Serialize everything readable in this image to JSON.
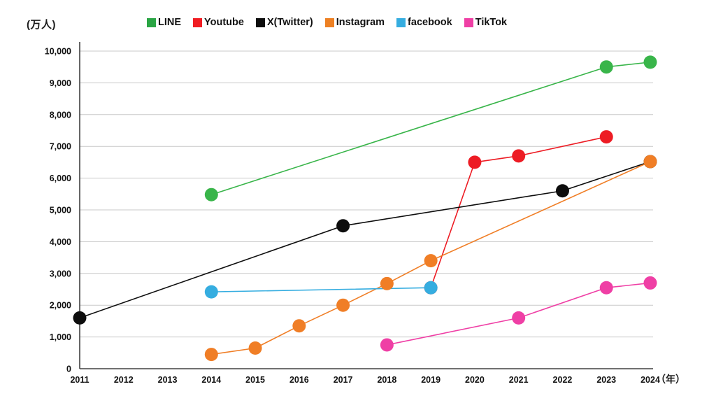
{
  "axis": {
    "y_unit_label": "(万人)",
    "x_unit_label": "（年）",
    "y_ticks": [
      "10,000",
      "9,000",
      "8,000",
      "7,000",
      "6,000",
      "5,000",
      "4,000",
      "3,000",
      "2,000",
      "1,000",
      "0"
    ],
    "x_ticks": [
      "2011",
      "2012",
      "2013",
      "2014",
      "2015",
      "2016",
      "2017",
      "2018",
      "2019",
      "2020",
      "2021",
      "2022",
      "2023",
      "2024"
    ]
  },
  "legend": {
    "items": [
      {
        "label": "LINE",
        "color": "#2aa544"
      },
      {
        "label": "Youtube",
        "color": "#f01c22"
      },
      {
        "label": "X(Twitter)",
        "color": "#0d0d0d"
      },
      {
        "label": "Instagram",
        "color": "#ed8023"
      },
      {
        "label": "facebook",
        "color": "#35ade0"
      },
      {
        "label": "TikTok",
        "color": "#ef3fa5"
      }
    ]
  },
  "colors": {
    "gridline": "#c9c9c9",
    "axis": "#404040",
    "background": "#ffffff",
    "line_green": "#39b54a",
    "line_red": "#ed1c24",
    "line_black": "#0d0d0d",
    "line_orange": "#f07e26",
    "line_blue": "#35ade0",
    "line_pink": "#ef3fa5"
  },
  "chart_data": {
    "type": "line",
    "title": "",
    "xlabel": "（年）",
    "ylabel": "(万人)",
    "x": [
      2011,
      2012,
      2013,
      2014,
      2015,
      2016,
      2017,
      2018,
      2019,
      2020,
      2021,
      2022,
      2023,
      2024
    ],
    "xlim": [
      2011,
      2024
    ],
    "ylim": [
      0,
      10000
    ],
    "y_tick_step": 1000,
    "grid": true,
    "legend_position": "top",
    "series": [
      {
        "name": "LINE",
        "color": "#39b54a",
        "points": [
          {
            "x": 2014,
            "y": 5480
          },
          {
            "x": 2023,
            "y": 9500
          },
          {
            "x": 2024,
            "y": 9650
          }
        ]
      },
      {
        "name": "Youtube",
        "color": "#ed1c24",
        "points": [
          {
            "x": 2019,
            "y": 2550
          },
          {
            "x": 2020,
            "y": 6500
          },
          {
            "x": 2021,
            "y": 6700
          },
          {
            "x": 2023,
            "y": 7300
          }
        ]
      },
      {
        "name": "X(Twitter)",
        "color": "#0d0d0d",
        "points": [
          {
            "x": 2011,
            "y": 1600
          },
          {
            "x": 2017,
            "y": 4500
          },
          {
            "x": 2022,
            "y": 5600
          },
          {
            "x": 2024,
            "y": 6520
          }
        ]
      },
      {
        "name": "Instagram",
        "color": "#f07e26",
        "points": [
          {
            "x": 2014,
            "y": 450
          },
          {
            "x": 2015,
            "y": 650
          },
          {
            "x": 2016,
            "y": 1350
          },
          {
            "x": 2017,
            "y": 2000
          },
          {
            "x": 2018,
            "y": 2680
          },
          {
            "x": 2019,
            "y": 3400
          },
          {
            "x": 2024,
            "y": 6520
          }
        ]
      },
      {
        "name": "facebook",
        "color": "#35ade0",
        "points": [
          {
            "x": 2014,
            "y": 2420
          },
          {
            "x": 2019,
            "y": 2550
          }
        ]
      },
      {
        "name": "TikTok",
        "color": "#ef3fa5",
        "points": [
          {
            "x": 2018,
            "y": 750
          },
          {
            "x": 2021,
            "y": 1600
          },
          {
            "x": 2023,
            "y": 2550
          },
          {
            "x": 2024,
            "y": 2700
          }
        ]
      }
    ]
  }
}
